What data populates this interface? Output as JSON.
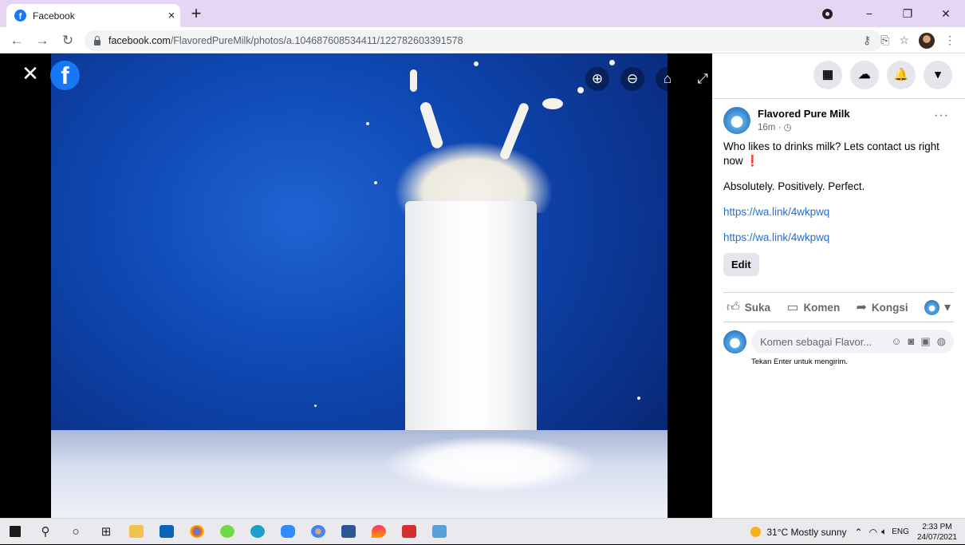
{
  "browser": {
    "tab_title": "Facebook",
    "tab_close": "×",
    "new_tab": "+",
    "url_domain": "facebook.com",
    "url_path": "/FlavoredPureMilk/photos/a.104687608534411/122782603391578"
  },
  "viewer": {
    "close_glyph": "✕",
    "logo_letter": "f"
  },
  "side": {
    "nav_glyphs": [
      "▦",
      "☁",
      "🔔",
      "▾"
    ]
  },
  "post": {
    "page_name": "Flavored Pure Milk",
    "time": "16m · ◷",
    "more": "···",
    "text_line1": "Who likes to drinks milk? Lets contact us right now",
    "red_mark": "❗",
    "text_line2": "Absolutely. Positively. Perfect.",
    "link1": "https://wa.link/4wkpwq",
    "link2": "https://wa.link/4wkpwq",
    "edit_label": "Edit"
  },
  "actions": {
    "like": "Suka",
    "comment": "Komen",
    "share": "Kongsi"
  },
  "comment": {
    "placeholder": "Komen sebagai Flavor...",
    "hint": "Tekan Enter untuk mengirim."
  },
  "taskbar": {
    "weather": "31°C  Mostly sunny",
    "lang": "ENG",
    "time": "2:33 PM",
    "date": "24/07/2021"
  },
  "icons": {
    "back": "arrow-left-icon",
    "forward": "arrow-right-icon",
    "reload": "reload-icon",
    "zoom_in": "zoom-in-icon",
    "zoom_out": "zoom-out-icon",
    "tag": "tag-icon",
    "fullscreen": "fullscreen-icon"
  },
  "colors": {
    "facebook_blue": "#1877f2",
    "tab_strip": "#e6d6f3",
    "link": "#216fdb"
  }
}
